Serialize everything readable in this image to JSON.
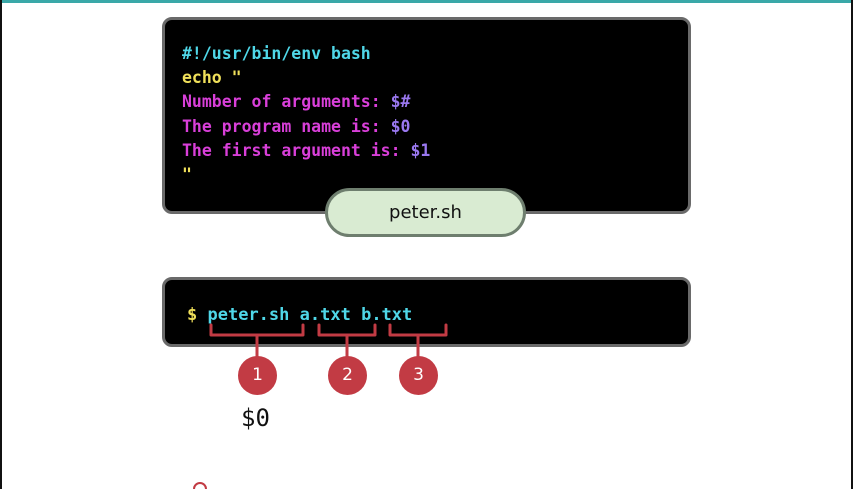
{
  "script": {
    "lines": [
      [
        {
          "text": "#!/usr/bin/env bash",
          "color": "#4fd7e8"
        }
      ],
      [
        {
          "text": "echo \"",
          "color": "#f0e05a"
        }
      ],
      [
        {
          "text": "Number of arguments: ",
          "color": "#d93fd9"
        },
        {
          "text": "$#",
          "color": "#9a78f0"
        }
      ],
      [
        {
          "text": "The program name is: ",
          "color": "#d93fd9"
        },
        {
          "text": "$0",
          "color": "#9a78f0"
        }
      ],
      [
        {
          "text": "The first argument is: ",
          "color": "#d93fd9"
        },
        {
          "text": "$1",
          "color": "#9a78f0"
        }
      ],
      [
        {
          "text": "\"",
          "color": "#f0e05a"
        }
      ]
    ],
    "filename": "peter.sh"
  },
  "command": {
    "prompt": "$",
    "program": "peter.sh",
    "arg1": "a.txt",
    "arg2": "b.txt"
  },
  "markers": [
    "1",
    "2",
    "3"
  ],
  "variable_label": "$0",
  "colors": {
    "bracket": "#c23b44",
    "marker": "#c23b44",
    "pill": "#d9ebd2",
    "accent": "#3aa8a8"
  }
}
